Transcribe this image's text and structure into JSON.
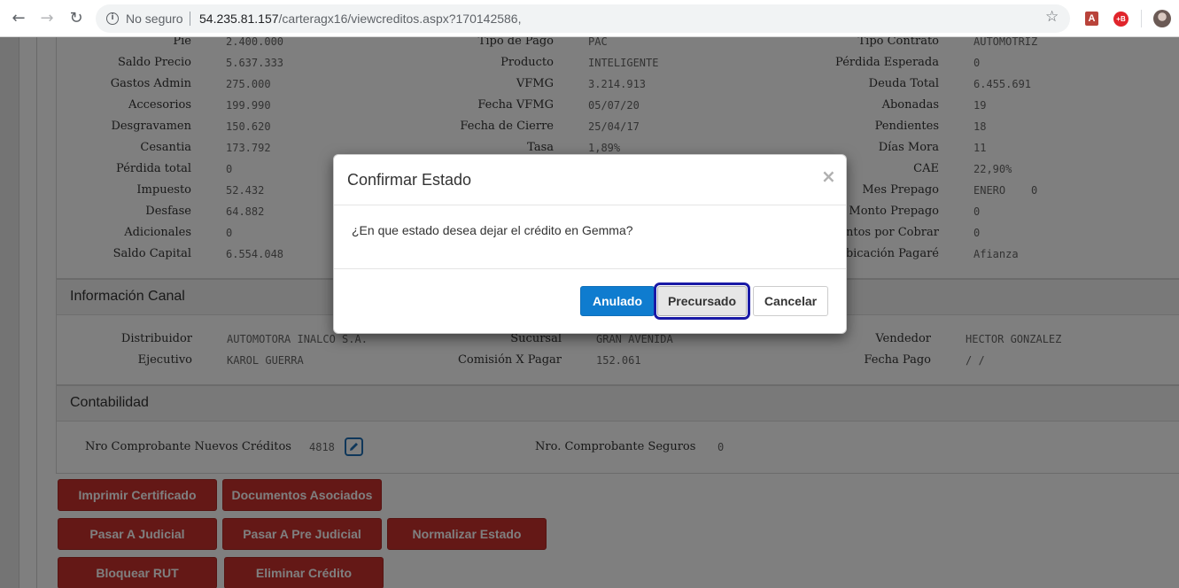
{
  "browser": {
    "back_icon": "←",
    "forward_icon": "→",
    "reload_icon": "↻",
    "security_icon": "i",
    "security_label": "No seguro",
    "url_host": "54.235.81.157",
    "url_path": "/carteragx16/viewcreditos.aspx?170142586,",
    "star_icon": "☆",
    "pdf_ext_label": "A",
    "red_ext_label": "+B"
  },
  "details": {
    "col1": [
      {
        "label": "Pie",
        "value": "2.400.000"
      },
      {
        "label": "Saldo Precio",
        "value": "5.637.333"
      },
      {
        "label": "Gastos Admin",
        "value": "275.000"
      },
      {
        "label": "Accesorios",
        "value": "199.990"
      },
      {
        "label": "Desgravamen",
        "value": "150.620"
      },
      {
        "label": "Cesantia",
        "value": "173.792"
      },
      {
        "label": "Pérdida total",
        "value": "0"
      },
      {
        "label": "Impuesto",
        "value": "52.432"
      },
      {
        "label": "Desfase",
        "value": "64.882"
      },
      {
        "label": "Adicionales",
        "value": "0"
      },
      {
        "label": "Saldo Capital",
        "value": "6.554.048"
      }
    ],
    "col2": [
      {
        "label": "Tipo de Pago",
        "value": "PAC"
      },
      {
        "label": "Producto",
        "value": "INTELIGENTE"
      },
      {
        "label": "VFMG",
        "value": "3.214.913"
      },
      {
        "label": "Fecha VFMG",
        "value": "05/07/20"
      },
      {
        "label": "Fecha de Cierre",
        "value": "25/04/17"
      },
      {
        "label": "Tasa",
        "value": "1,89%"
      }
    ],
    "col3": [
      {
        "label": "Tipo Contrato",
        "value": "AUTOMOTRIZ"
      },
      {
        "label": "Pérdida Esperada",
        "value": "0"
      },
      {
        "label": "Deuda Total",
        "value": "6.455.691"
      },
      {
        "label": "Abonadas",
        "value": "19"
      },
      {
        "label": "Pendientes",
        "value": "18"
      },
      {
        "label": "Días Mora",
        "value": "11"
      },
      {
        "label": "CAE",
        "value": "22,90%"
      },
      {
        "label": "Mes Prepago",
        "value": "ENERO",
        "extra": "0"
      },
      {
        "label": "Monto Prepago",
        "value": "0"
      },
      {
        "label": "entos por Cobrar",
        "value": "0"
      },
      {
        "label": "Ubicación Pagaré",
        "value": "Afianza"
      }
    ]
  },
  "canal": {
    "title": "Información Canal",
    "distribuidor_label": "Distribuidor",
    "distribuidor_value": "AUTOMOTORA INALCO S.A.",
    "ejecutivo_label": "Ejecutivo",
    "ejecutivo_value": "KAROL GUERRA",
    "sucursal_label": "Sucursal",
    "sucursal_value": "GRAN AVENIDA",
    "comision_label": "Comisión X Pagar",
    "comision_value": "152.061",
    "vendedor_label": "Vendedor",
    "vendedor_value": "HECTOR GONZALEZ",
    "fecha_pago_label": "Fecha Pago",
    "fecha_pago_value": "/ /"
  },
  "contabilidad": {
    "title": "Contabilidad",
    "nuevos_label": "Nro Comprobante Nuevos Créditos",
    "nuevos_value": "4818",
    "seguros_label": "Nro. Comprobante Seguros",
    "seguros_value": "0"
  },
  "actions": {
    "imprimir": "Imprimir Certificado",
    "documentos": "Documentos Asociados",
    "judicial": "Pasar A Judicial",
    "pre_judicial": "Pasar A Pre Judicial",
    "normalizar": "Normalizar Estado",
    "bloquear": "Bloquear RUT",
    "eliminar": "Eliminar Crédito"
  },
  "modal": {
    "title": "Confirmar Estado",
    "close": "×",
    "message": "¿En que estado desea dejar el crédito en Gemma?",
    "btn_anulado": "Anulado",
    "btn_precursado": "Precursado",
    "btn_cancelar": "Cancelar"
  }
}
